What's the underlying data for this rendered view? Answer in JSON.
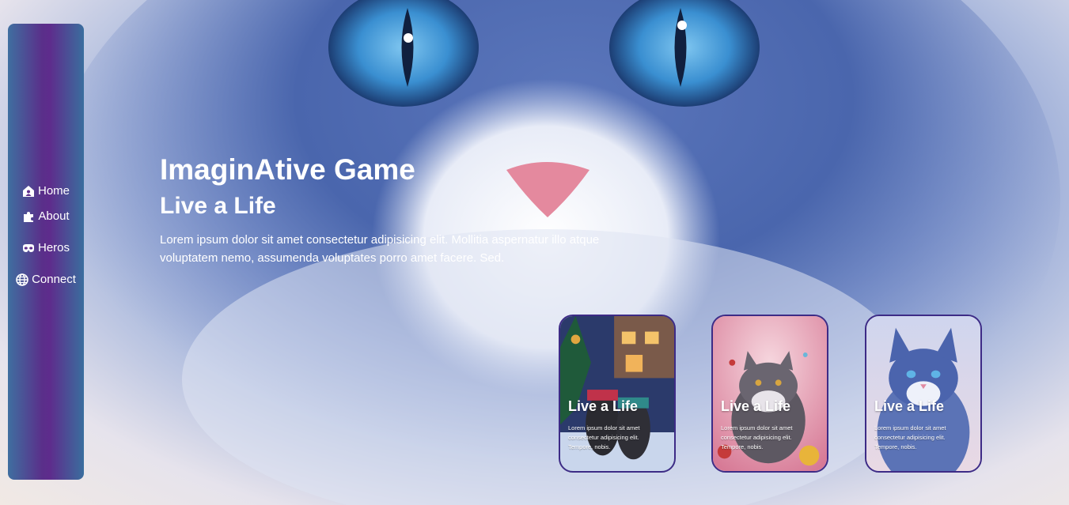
{
  "sidebar": {
    "items": [
      {
        "label": "Home",
        "icon": "home-user-icon"
      },
      {
        "label": "About",
        "icon": "puzzle-icon"
      },
      {
        "label": "Heros",
        "icon": "mask-icon"
      },
      {
        "label": "Connect",
        "icon": "globe-icon"
      }
    ]
  },
  "hero": {
    "title": "ImaginAtive Game",
    "subtitle": "Live a Life",
    "text": "Lorem ipsum dolor sit amet consectetur adipisicing elit. Mollitia aspernatur illo atque voluptatem nemo, assumenda voluptates porro amet facere. Sed."
  },
  "cards": [
    {
      "title": "Live a Life",
      "text": "Lorem ipsum dolor sit amet consectetur adipisicing elit. Tempore, nobis."
    },
    {
      "title": "Live a Life",
      "text": "Lorem ipsum dolor sit amet consectetur adipisicing elit. Tempore, nobis."
    },
    {
      "title": "Live a Life",
      "text": "Lorem ipsum dolor sit amet consectetur adipisicing elit. Tempore, nobis."
    }
  ],
  "colors": {
    "sidebar_purple": "#5e2c8c",
    "sidebar_blue": "#3f6fa0",
    "card_border": "#3d2b86",
    "text": "#ffffff"
  }
}
